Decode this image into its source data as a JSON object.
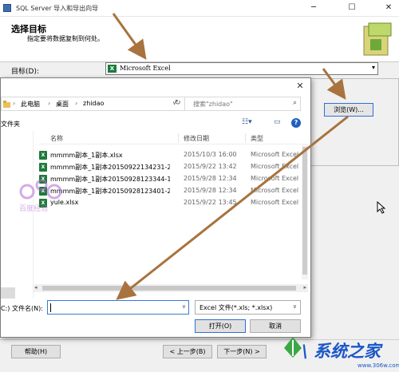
{
  "wizard": {
    "title": "SQL Server 导入和导出向导",
    "heading": "选择目标",
    "subheading": "指定要将数据复制到何处。",
    "destination_label": "目标(D):",
    "destination_value": "Microsoft Excel",
    "browse_label": "浏览(W)...",
    "buttons": {
      "help": "帮助(H)",
      "back": "< 上一步(B)",
      "next": "下一步(N) >"
    }
  },
  "dialog": {
    "breadcrumb": [
      "此电脑",
      "桌面",
      "zhidao"
    ],
    "search_placeholder": "搜索\"zhidao\"",
    "folder_label": "文件夹",
    "nav_drive_label": "C:)",
    "columns": {
      "name": "名称",
      "date": "修改日期",
      "type": "类型"
    },
    "files": [
      {
        "name": "mmmm副本_1副本.xlsx",
        "date": "2015/10/3 16:00",
        "type": "Microsoft Excel"
      },
      {
        "name": "mmmm副本_1副本20150922134231-2...",
        "date": "2015/9/22 13:42",
        "type": "Microsoft Excel"
      },
      {
        "name": "mmmm副本_1副本20150928123344-1...",
        "date": "2015/9/28 12:34",
        "type": "Microsoft Excel"
      },
      {
        "name": "mmmm副本_1副本20150928123401-2...",
        "date": "2015/9/28 12:34",
        "type": "Microsoft Excel"
      },
      {
        "name": "yule.xlsx",
        "date": "2015/9/22 13:45",
        "type": "Microsoft Excel"
      }
    ],
    "filename_label": "文件名(N):",
    "filename_value": "",
    "filetype_value": "Excel 文件(*.xls; *.xlsx)",
    "open_label": "打开(O)",
    "cancel_label": "取消"
  },
  "watermarks": {
    "left": "百度经验",
    "right_brand": "\\ 系统之家",
    "right_url": "www.306w.com"
  },
  "colors": {
    "excel_green": "#1f7a3b",
    "accent_blue": "#2f6fd6",
    "arrow_brown": "#a8733e"
  }
}
